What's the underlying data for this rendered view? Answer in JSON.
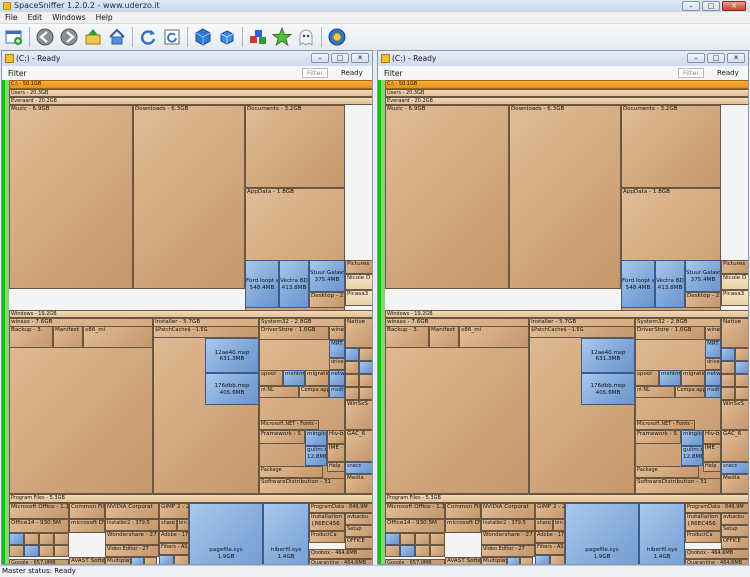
{
  "window": {
    "title": "SpaceSniffer 1.2.0.2 - www.uderzo.it",
    "min_glyph": "–",
    "max_glyph": "□",
    "close_glyph": "✕"
  },
  "menu": [
    "File",
    "Edit",
    "Windows",
    "Help"
  ],
  "toolbar": [
    {
      "icon": "new-window-icon"
    },
    {
      "icon": "back-icon"
    },
    {
      "icon": "forward-icon"
    },
    {
      "icon": "up-icon"
    },
    {
      "icon": "home-icon"
    },
    {
      "icon": "refresh-icon"
    },
    {
      "icon": "refresh-all-icon"
    },
    {
      "icon": "zoom-in-cube-icon"
    },
    {
      "icon": "zoom-out-cube-icon"
    },
    {
      "icon": "tag-users-icon"
    },
    {
      "icon": "star-icon"
    },
    {
      "icon": "ghost-icon"
    },
    {
      "icon": "settings-gear-icon"
    }
  ],
  "panes": [
    {
      "title": "(C:) - Ready",
      "filter_label": "Filter",
      "filter_placeholder": "Filter",
      "status": "Ready"
    },
    {
      "title": "(C:) - Ready",
      "filter_label": "Filter",
      "filter_placeholder": "Filter",
      "status": "Ready"
    }
  ],
  "treemap": [
    {
      "label": "C:\\ - 50.1GB",
      "cls": "orange"
    },
    {
      "label": "Users - 20.3GB",
      "cls": "strip"
    },
    {
      "label": "Everaard - 20.2GB",
      "cls": "strip"
    },
    {
      "label": "Music - 6.9GB",
      "cls": ""
    },
    {
      "label": "Downloads - 6.3GB",
      "cls": ""
    },
    {
      "label": "Documents - 3.2GB",
      "cls": ""
    },
    {
      "label": "AppData - 1.8GB",
      "cls": ""
    },
    {
      "label": "Ford loopt wa\n548.4MB",
      "cls": "blue"
    },
    {
      "label": "Vectra BD\n413.8MB",
      "cls": "blue"
    },
    {
      "label": "Stuur Galaxy_2\n375.4MB",
      "cls": "blue"
    },
    {
      "label": "Desktop - 230.",
      "cls": ""
    },
    {
      "label": "Pictures",
      "cls": ""
    },
    {
      "label": "Nicole D",
      "cls": "pale"
    },
    {
      "label": "Picasa3",
      "cls": "pale"
    },
    {
      "label": "Windows - 19.2GB",
      "cls": "strip"
    },
    {
      "label": "winsxs - 7.6GB",
      "cls": ""
    },
    {
      "label": "Installer - 5.7GB",
      "cls": ""
    },
    {
      "label": "System32 - 2.8GB",
      "cls": ""
    },
    {
      "label": "Native",
      "cls": ""
    },
    {
      "label": "Backup - 3.",
      "cls": ""
    },
    {
      "label": "Manifest",
      "cls": ""
    },
    {
      "label": "x86_mi",
      "cls": ""
    },
    {
      "label": "$PatchCache$ - 1.5G",
      "cls": ""
    },
    {
      "label": "12ae40.msp\n631.3MB",
      "cls": "blue"
    },
    {
      "label": "176dbb.msp\n405.6MB",
      "cls": "blue"
    },
    {
      "label": "DriverStore - 1.0GB",
      "cls": ""
    },
    {
      "label": "winevt",
      "cls": ""
    },
    {
      "label": "MRT.ex",
      "cls": "blue"
    },
    {
      "label": "drivers",
      "cls": ""
    },
    {
      "label": "spool",
      "cls": ""
    },
    {
      "label": "mshtml",
      "cls": "blue"
    },
    {
      "label": "migratio",
      "cls": ""
    },
    {
      "label": "network",
      "cls": "blue"
    },
    {
      "label": "nl-NL",
      "cls": ""
    },
    {
      "label": "Compa app",
      "cls": ""
    },
    {
      "label": "msdt.ex",
      "cls": "blue"
    },
    {
      "label": "WinSxS",
      "cls": ""
    },
    {
      "label": "GAC_6",
      "cls": ""
    },
    {
      "label": "Microsoft.NET - Fonts - 3",
      "cls": ""
    },
    {
      "label": "Framework - 5",
      "cls": ""
    },
    {
      "label": "mingliu",
      "cls": "blue"
    },
    {
      "label": "gulim.ttc\n12.8MB",
      "cls": "blue"
    },
    {
      "label": "Hiv-back",
      "cls": ""
    },
    {
      "label": "IME - 1",
      "cls": ""
    },
    {
      "label": "Help",
      "cls": ""
    },
    {
      "label": "snacc",
      "cls": "blue"
    },
    {
      "label": "Media",
      "cls": ""
    },
    {
      "label": "Package",
      "cls": ""
    },
    {
      "label": "SoftwareDistribution - 31",
      "cls": ""
    },
    {
      "label": "Program Files - 5.3GB",
      "cls": "strip"
    },
    {
      "label": "Microsoft Office - 1.1GB",
      "cls": ""
    },
    {
      "label": "Office14 - 930.5M",
      "cls": ""
    },
    {
      "label": "Common Files",
      "cls": ""
    },
    {
      "label": "microsoft DVD",
      "cls": ""
    },
    {
      "label": "NVIDIA Corporat",
      "cls": ""
    },
    {
      "label": "Installer2 - 379.5",
      "cls": ""
    },
    {
      "label": "GIMP 2 - 256",
      "cls": ""
    },
    {
      "label": "share",
      "cls": ""
    },
    {
      "label": "bin",
      "cls": ""
    },
    {
      "label": "Adobe - 176.",
      "cls": ""
    },
    {
      "label": "Wondershare - 27",
      "cls": ""
    },
    {
      "label": "Video Editor - 27",
      "cls": ""
    },
    {
      "label": "Filters - AS",
      "cls": ""
    },
    {
      "label": "Google - 657.0MB",
      "cls": ""
    },
    {
      "label": "Chrome - 459.3",
      "cls": ""
    },
    {
      "label": "Updat",
      "cls": ""
    },
    {
      "label": "AVAST Softw",
      "cls": ""
    },
    {
      "label": "Avast - 307.6",
      "cls": ""
    },
    {
      "label": "Multiplay",
      "cls": ""
    },
    {
      "label": "VLC - 97",
      "cls": ""
    },
    {
      "label": "Anima",
      "cls": ""
    },
    {
      "label": "pagefile.sys\n1.9GB",
      "cls": "blue"
    },
    {
      "label": "hiberfil.sys\n1.4GB",
      "cls": "blue"
    },
    {
      "label": "ProgramData - 849.9M",
      "cls": ""
    },
    {
      "label": "Installation\n{86EC456",
      "cls": ""
    },
    {
      "label": "avbacku",
      "cls": ""
    },
    {
      "label": "Setup",
      "cls": ""
    },
    {
      "label": "ProductCa",
      "cls": ""
    },
    {
      "label": "OFFICE",
      "cls": ""
    },
    {
      "label": "Qoobox - 464.6MB",
      "cls": ""
    },
    {
      "label": "Quarantine - 464.6MB",
      "cls": ""
    },
    {
      "label": "Dell - 240.1",
      "cls": ""
    },
    {
      "label": "NVIDIA",
      "cls": ""
    },
    {
      "label": "Drivers - 2",
      "cls": ""
    },
    {
      "label": "195.62",
      "cls": ""
    }
  ],
  "status_text": "Master status: Ready"
}
